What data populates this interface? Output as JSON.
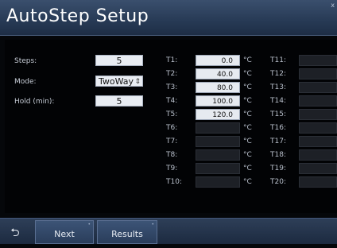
{
  "header": {
    "title": "AutoStep Setup",
    "corner_mark": "x"
  },
  "settings": {
    "steps": {
      "label": "Steps:",
      "value": "5"
    },
    "mode": {
      "label": "Mode:",
      "value": "TwoWay",
      "arrow": "⇕"
    },
    "hold": {
      "label": "Hold (min):",
      "value": "5"
    }
  },
  "unit": "°C",
  "temps": [
    {
      "label": "T1:",
      "value": "0.0"
    },
    {
      "label": "T2:",
      "value": "40.0"
    },
    {
      "label": "T3:",
      "value": "80.0"
    },
    {
      "label": "T4:",
      "value": "100.0"
    },
    {
      "label": "T5:",
      "value": "120.0"
    },
    {
      "label": "T6:",
      "value": ""
    },
    {
      "label": "T7:",
      "value": ""
    },
    {
      "label": "T8:",
      "value": ""
    },
    {
      "label": "T9:",
      "value": ""
    },
    {
      "label": "T10:",
      "value": ""
    },
    {
      "label": "T11:",
      "value": ""
    },
    {
      "label": "T12:",
      "value": ""
    },
    {
      "label": "T13:",
      "value": ""
    },
    {
      "label": "T14:",
      "value": ""
    },
    {
      "label": "T15:",
      "value": ""
    },
    {
      "label": "T16:",
      "value": ""
    },
    {
      "label": "T17:",
      "value": ""
    },
    {
      "label": "T18:",
      "value": ""
    },
    {
      "label": "T19:",
      "value": ""
    },
    {
      "label": "T20:",
      "value": ""
    }
  ],
  "footer": {
    "back_icon": "back-arrow-icon",
    "back_glyph": "⮌",
    "next_label": "Next",
    "results_label": "Results",
    "button_dot": "•"
  }
}
